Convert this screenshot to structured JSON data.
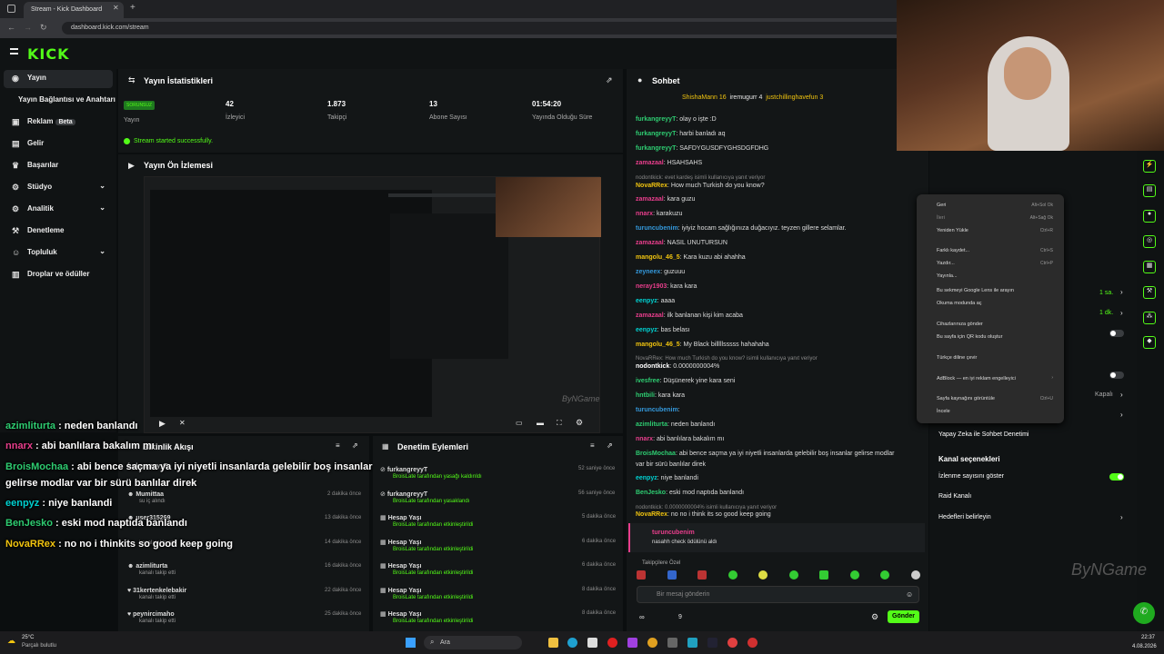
{
  "browser": {
    "tab_title": "Stream - Kick Dashboard",
    "url": "dashboard.kick.com/stream"
  },
  "brand": {
    "logo": "KICK",
    "accent": "#53fc18"
  },
  "sidebar": {
    "items": [
      {
        "label": "Yayın",
        "icon": "radio-icon"
      },
      {
        "label": "Yayın Bağlantısı ve Anahtarı",
        "icon": "key-icon"
      },
      {
        "label": "Reklam",
        "badge": "Beta",
        "icon": "megaphone-icon"
      },
      {
        "label": "Gelir",
        "icon": "money-icon"
      },
      {
        "label": "Başarılar",
        "icon": "trophy-icon"
      },
      {
        "label": "Stüdyo",
        "icon": "studio-icon"
      },
      {
        "label": "Analitik",
        "icon": "chart-icon"
      },
      {
        "label": "Denetleme",
        "icon": "shield-icon"
      },
      {
        "label": "Topluluk",
        "icon": "people-icon"
      },
      {
        "label": "Droplar ve ödüller",
        "icon": "gift-icon"
      }
    ]
  },
  "stats": {
    "title": "Yayın İstatistikleri",
    "badge": "SORUNSUZ",
    "items": [
      {
        "value": "",
        "label": "Yayın"
      },
      {
        "value": "42",
        "label": "İzleyici"
      },
      {
        "value": "1.873",
        "label": "Takipçi"
      },
      {
        "value": "13",
        "label": "Abone Sayısı"
      },
      {
        "value": "01:54:20",
        "label": "Yayında Olduğu Süre"
      }
    ],
    "success": "Stream started successfully."
  },
  "preview": {
    "title": "Yayın Ön İzlemesi",
    "watermark": "ByNGame"
  },
  "activity": {
    "title": "Etkinlik Akışı",
    "rows": [
      {
        "user": "furkangreyyT",
        "sub": "",
        "time": ""
      },
      {
        "user": "Mumittaa",
        "sub": "su iç alındı",
        "time": "2 dakika önce"
      },
      {
        "user": "user315269",
        "sub": "",
        "time": "13 dakika önce"
      },
      {
        "user": "",
        "sub": "kanalı takip etti",
        "time": "14 dakika önce"
      },
      {
        "user": "azimliturta",
        "sub": "kanalı takip etti",
        "time": "16 dakika önce"
      },
      {
        "user": "31kertenkelebakir",
        "sub": "kanalı takip etti",
        "time": "22 dakika önce"
      },
      {
        "user": "peynircimaho",
        "sub": "kanalı takip etti",
        "time": "25 dakika önce"
      }
    ]
  },
  "moderation": {
    "title": "Denetim Eylemleri",
    "rows": [
      {
        "user": "furkangreyyT",
        "sub": "BroisLate tarafından yasağı kaldırıldı",
        "time": "52 saniye önce"
      },
      {
        "user": "furkangreyyT",
        "sub": "BroisLate tarafından yasaklandı",
        "time": "56 saniye önce"
      },
      {
        "user": "Hesap Yaşı",
        "sub": "BroisLate tarafından etkinleştirildi",
        "time": "5 dakika önce"
      },
      {
        "user": "Hesap Yaşı",
        "sub": "BroisLate tarafından etkinleştirildi",
        "time": "6 dakika önce"
      },
      {
        "user": "Hesap Yaşı",
        "sub": "BroisLate tarafından etkinleştirildi",
        "time": "6 dakika önce"
      },
      {
        "user": "Hesap Yaşı",
        "sub": "BroisLate tarafından etkinleştirildi",
        "time": "8 dakika önce"
      },
      {
        "user": "Hesap Yaşı",
        "sub": "BroisLate tarafından etkinleştirildi",
        "time": "8 dakika önce"
      }
    ]
  },
  "chat": {
    "title": "Sohbet",
    "top": [
      "ShishaMann 16",
      "iremugurr 4",
      "justchillinghavefun 3"
    ],
    "lines": [
      {
        "u": "furkangreyyT",
        "c": "#2ecc71",
        "t": "olay o işte :D"
      },
      {
        "u": "furkangreyyT",
        "c": "#2ecc71",
        "t": "harbi banladı aq"
      },
      {
        "u": "furkangreyyT",
        "c": "#2ecc71",
        "t": "SAFDYGUSDFYGHSDGFDHG"
      },
      {
        "u": "zamazaal",
        "c": "#e83e8c",
        "t": "HSAHSAHS"
      },
      {
        "u": "",
        "c": "#888",
        "t": "nodontkick: evet kardeş isimli kullanıcıya yanıt veriyor"
      },
      {
        "u": "NovaRRex",
        "c": "#f1c40f",
        "t": "How much Turkish do you know?"
      },
      {
        "u": "zamazaal",
        "c": "#e83e8c",
        "t": "kara guzu"
      },
      {
        "u": "nnarx",
        "c": "#e83e8c",
        "t": "karakuzu"
      },
      {
        "u": "turuncubenim",
        "c": "#3498db",
        "t": "iyiyiz hocam sağlığınıza duğacıyız. teyzen gillere selamlar."
      },
      {
        "u": "zamazaal",
        "c": "#e83e8c",
        "t": "NASIL UNUTURSUN"
      },
      {
        "u": "mangolu_46_5",
        "c": "#f1c40f",
        "t": "Kara kuzu abi ahahha"
      },
      {
        "u": "zeyneex",
        "c": "#3498db",
        "t": "guzuuu"
      },
      {
        "u": "neray1903",
        "c": "#e83e8c",
        "t": "kara kara"
      },
      {
        "u": "eenpyz",
        "c": "#00d1d1",
        "t": "aaaa"
      },
      {
        "u": "zamazaal",
        "c": "#e83e8c",
        "t": "ilk banlanan kişi kim acaba"
      },
      {
        "u": "eenpyz",
        "c": "#00d1d1",
        "t": "bas belası"
      },
      {
        "u": "mangolu_46_5",
        "c": "#f1c40f",
        "t": "My Black billlllsssss hahahaha"
      },
      {
        "u": "",
        "c": "#888",
        "t": "NovaRRex: How much Turkish do you know? isimli kullanıcıya yanıt veriyor"
      },
      {
        "u": "nodontkick",
        "c": "#ffffff",
        "t": "0.0000000004%"
      },
      {
        "u": "ivesfree",
        "c": "#2ecc71",
        "t": "Düşünerek yine kara seni"
      },
      {
        "u": "hntbili",
        "c": "#2ecc71",
        "t": "kara kara"
      },
      {
        "u": "turuncubenim",
        "c": "#3498db",
        "t": ""
      },
      {
        "u": "azimliturta",
        "c": "#2ecc71",
        "t": "neden banlandı"
      },
      {
        "u": "nnarx",
        "c": "#e83e8c",
        "t": "abi banlılara bakalım mı"
      },
      {
        "u": "BroisMochaa",
        "c": "#2ecc71",
        "t": "abi bence saçma ya iyi niyetli insanlarda gelebilir boş insanlar gelirse modlar"
      },
      {
        "u": "",
        "c": "#ddd",
        "t": "var bir sürü banlılar direk"
      },
      {
        "u": "eenpyz",
        "c": "#00d1d1",
        "t": "niye banlandi"
      },
      {
        "u": "BenJesko",
        "c": "#2ecc71",
        "t": "eski mod naptıda banlandı"
      },
      {
        "u": "",
        "c": "#888",
        "t": "nodontkick: 0.0000000004% isimli kullanıcıya yanıt veriyor"
      },
      {
        "u": "NovaRRex",
        "c": "#f1c40f",
        "t": "no no i think its so good keep going"
      }
    ],
    "pinned": {
      "user": "turuncubenim",
      "text": "nasahh check ödülünü aldı"
    },
    "followers_label": "Takipçilere Özel",
    "input_placeholder": "Bir mesaj gönderin",
    "count": "9",
    "send": "Gönder"
  },
  "overlay_chat": [
    {
      "u": "azimliturta",
      "c": "#2ecc71",
      "t": " : neden banlandı"
    },
    {
      "u": "nnarx",
      "c": "#e83e8c",
      "t": " : abi banlılara bakalım mı"
    },
    {
      "u": "BroisMochaa",
      "c": "#2ecc71",
      "t": " : abi bence saçma ya iyi niyetli insanlarda gelebilir boş insanlar"
    },
    {
      "u": "",
      "c": "#fff",
      "t": "gelirse modlar var bir sürü banlılar direk"
    },
    {
      "u": "eenpyz",
      "c": "#00d1d1",
      "t": " : niye banlandi"
    },
    {
      "u": "BenJesko",
      "c": "#2ecc71",
      "t": " : eski mod naptıda banlandı"
    },
    {
      "u": "NovaRRex",
      "c": "#f1c40f",
      "t": " : no no i thinkits so good keep going"
    }
  ],
  "context_menu": {
    "items": [
      {
        "l": "Geri",
        "k": "Alt+Sol Ok"
      },
      {
        "l": "İleri",
        "k": "Alt+Sağ Ok"
      },
      {
        "l": "Yeniden Yükle",
        "k": "Ctrl+R"
      },
      {
        "l": "Farklı kaydet...",
        "k": "Ctrl+S"
      },
      {
        "l": "Yazdır...",
        "k": "Ctrl+P"
      },
      {
        "l": "Yayınla...",
        "k": ""
      },
      {
        "l": "Bu sekmeyi Google Lens ile arayın",
        "k": ""
      },
      {
        "l": "Okuma modunda aç",
        "k": ""
      },
      {
        "l": "Cihazlarınıza gönder",
        "k": ""
      },
      {
        "l": "Bu sayfa için QR kodu oluştur",
        "k": ""
      },
      {
        "l": "Türkçe diline çevir",
        "k": ""
      },
      {
        "l": "AdBlock — en iyi reklam engelleyici",
        "k": ""
      },
      {
        "l": "Sayfa kaynağını görüntüle",
        "k": "Ctrl+U"
      },
      {
        "l": "İncele",
        "k": ""
      }
    ]
  },
  "right_panel": {
    "times": [
      "1 sa.",
      "1 dk."
    ],
    "kapali": "Kapalı",
    "ai": "Yapay Zeka ile Sohbet Denetimi",
    "channel_opts": "Kanal seçenekleri",
    "show_views": "İzlenme sayısını göster",
    "raid": "Raid Kanalı",
    "goals": "Hedefleri belirleyin",
    "watermark": "ByNGame"
  },
  "taskbar": {
    "temp": "25°C",
    "weather": "Parçalı bulutlu",
    "search": "Ara",
    "time": "22:37",
    "date": "4.08.2026"
  }
}
